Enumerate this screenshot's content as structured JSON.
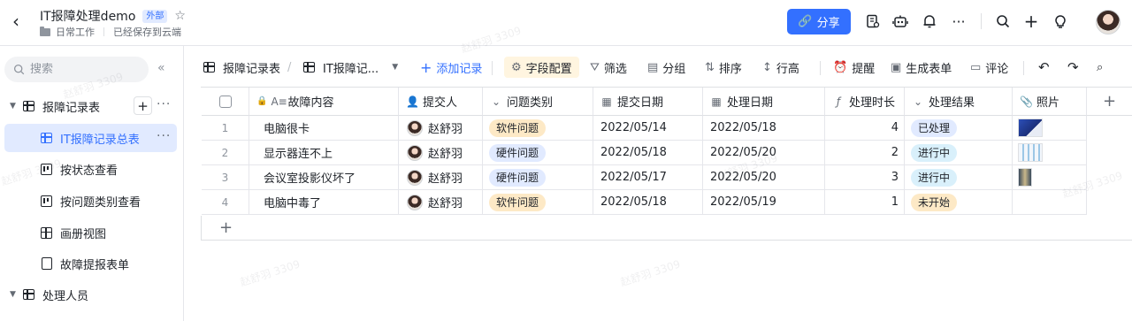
{
  "header": {
    "title": "IT报障处理demo",
    "badge": "外部",
    "breadcrumb": "日常工作",
    "save_status": "已经保存到云端",
    "share_label": "分享"
  },
  "sidebar": {
    "search_placeholder": "搜索",
    "items": [
      {
        "label": "报障记录表"
      },
      {
        "label": "IT报障记录总表"
      },
      {
        "label": "按状态查看"
      },
      {
        "label": "按问题类别查看"
      },
      {
        "label": "画册视图"
      },
      {
        "label": "故障提报表单"
      },
      {
        "label": "处理人员"
      }
    ]
  },
  "toolbar": {
    "table_name": "报障记录表",
    "view_name": "IT报障记...",
    "add_record": "添加记录",
    "field_config": "字段配置",
    "filter": "筛选",
    "group": "分组",
    "sort": "排序",
    "row_height": "行高",
    "remind": "提醒",
    "gen_form": "生成表单",
    "comment": "评论"
  },
  "grid": {
    "columns": [
      "故障内容",
      "提交人",
      "问题类别",
      "提交日期",
      "处理日期",
      "处理时长",
      "处理结果",
      "照片"
    ],
    "rows": [
      {
        "idx": "1",
        "content": "电脑很卡",
        "submitter": "赵舒羽",
        "category": "软件问题",
        "submit_date": "2022/05/14",
        "handle_date": "2022/05/18",
        "duration": "4",
        "result": "已处理"
      },
      {
        "idx": "2",
        "content": "显示器连不上",
        "submitter": "赵舒羽",
        "category": "硬件问题",
        "submit_date": "2022/05/18",
        "handle_date": "2022/05/20",
        "duration": "2",
        "result": "进行中"
      },
      {
        "idx": "3",
        "content": "会议室投影仪坏了",
        "submitter": "赵舒羽",
        "category": "硬件问题",
        "submit_date": "2022/05/17",
        "handle_date": "2022/05/20",
        "duration": "3",
        "result": "进行中"
      },
      {
        "idx": "4",
        "content": "电脑中毒了",
        "submitter": "赵舒羽",
        "category": "软件问题",
        "submit_date": "2022/05/18",
        "handle_date": "2022/05/19",
        "duration": "1",
        "result": "未开始"
      }
    ]
  },
  "colors": {
    "accent": "#3370ff",
    "tag_software_bg": "#fde9c6",
    "tag_hardware_bg": "#e1eaff",
    "tag_done_bg": "#e1eaff",
    "tag_progress_bg": "#d9f0fb",
    "tag_todo_bg": "#fde9c6"
  },
  "watermark": "赵舒羽 3309"
}
